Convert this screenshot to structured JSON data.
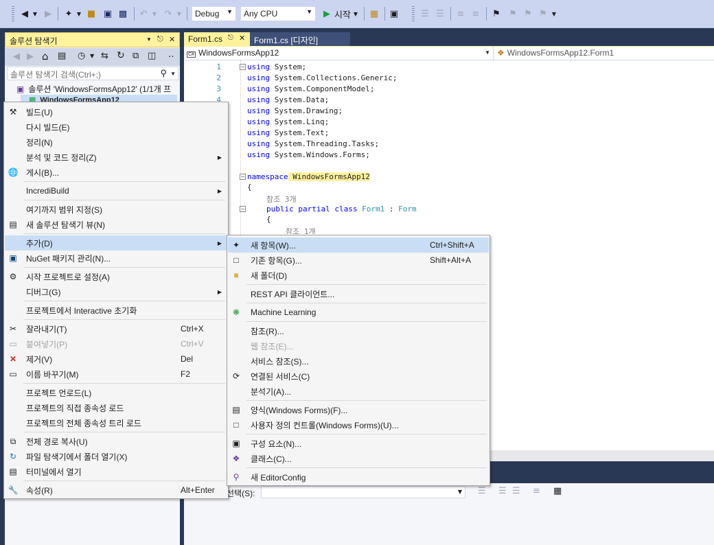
{
  "toolbar": {
    "config": "Debug",
    "platform": "Any CPU",
    "start_label": "시작"
  },
  "solution_explorer": {
    "title": "솔루션 탐색기",
    "search_placeholder": "솔루션 탐색기 검색(Ctrl+;)",
    "solution_item": "솔루션 'WindowsFormsApp12' (1/1개 프",
    "project_item": "WindowsFormsApp12"
  },
  "editor": {
    "tabs": [
      {
        "label": "Form1.cs"
      },
      {
        "label": "Form1.cs [디자인]"
      }
    ],
    "nav_left": "WindowsFormsApp12",
    "nav_right": "WindowsFormsApp12.Form1",
    "line_numbers": [
      "1",
      "2",
      "3",
      "4"
    ],
    "code_lines": [
      {
        "kw": "using",
        "rest": " System;"
      },
      {
        "kw": "using",
        "rest": " System.Collections.Generic;"
      },
      {
        "kw": "using",
        "rest": " System.ComponentModel;"
      },
      {
        "kw": "using",
        "rest": " System.Data;"
      },
      {
        "kw": "using",
        "rest": " System.Drawing;"
      },
      {
        "kw": "using",
        "rest": " System.Linq;"
      },
      {
        "kw": "using",
        "rest": " System.Text;"
      },
      {
        "kw": "using",
        "rest": " System.Threading.Tasks;"
      },
      {
        "kw": "using",
        "rest": " System.Windows.Forms;"
      }
    ],
    "namespace_kw": "namespace",
    "namespace_name": " WindowsFormsApp12",
    "open_brace": "{",
    "ref_count_1": "참조 3개",
    "class_public": "public",
    "class_partial": " partial",
    "class_kw": " class",
    "class_name": " Form1",
    "class_colon": " : ",
    "class_base": "Form",
    "open_brace2": "{",
    "ref_count_2": "참조 1개"
  },
  "properties_bar": {
    "select_label": "선택(S):"
  },
  "context_menu": {
    "items": [
      {
        "label": "빌드(U)",
        "icon": "build-icon"
      },
      {
        "label": "다시 빌드(E)"
      },
      {
        "label": "정리(N)"
      },
      {
        "label": "분석 및 코드 정리(Z)",
        "submenu": true
      },
      {
        "label": "게시(B)...",
        "icon": "globe-icon"
      },
      {
        "label": "IncrediBuild",
        "submenu": true
      },
      {
        "label": "여기까지 범위 지정(S)"
      },
      {
        "label": "새 솔루션 탐색기 뷰(N)",
        "icon": "new-view-icon"
      },
      {
        "label": "추가(D)",
        "submenu": true
      },
      {
        "label": "NuGet 패키지 관리(N)...",
        "icon": "nuget-icon"
      },
      {
        "label": "시작 프로젝트로 설정(A)",
        "icon": "gear-icon"
      },
      {
        "label": "디버그(G)",
        "submenu": true
      },
      {
        "label": "프로젝트에서 Interactive 초기화"
      },
      {
        "label": "잘라내기(T)",
        "shortcut": "Ctrl+X",
        "icon": "cut-icon"
      },
      {
        "label": "붙여넣기(P)",
        "shortcut": "Ctrl+V",
        "icon": "paste-icon",
        "disabled": true
      },
      {
        "label": "제거(V)",
        "shortcut": "Del",
        "icon": "delete-icon"
      },
      {
        "label": "이름 바꾸기(M)",
        "shortcut": "F2",
        "icon": "rename-icon"
      },
      {
        "label": "프로젝트 언로드(L)"
      },
      {
        "label": "프로젝트의 직접 종속성 로드"
      },
      {
        "label": "프로젝트의 전체 종속성 트리 로드"
      },
      {
        "label": "전체 경로 복사(U)",
        "icon": "copy-icon"
      },
      {
        "label": "파일 탐색기에서 폴더 열기(X)",
        "icon": "folder-open-icon"
      },
      {
        "label": "터미널에서 열기",
        "icon": "terminal-icon"
      },
      {
        "label": "속성(R)",
        "shortcut": "Alt+Enter",
        "icon": "wrench-icon"
      }
    ]
  },
  "add_submenu": {
    "items": [
      {
        "label": "새 항목(W)...",
        "shortcut": "Ctrl+Shift+A",
        "icon": "new-item-icon"
      },
      {
        "label": "기존 항목(G)...",
        "shortcut": "Shift+Alt+A",
        "icon": "existing-item-icon"
      },
      {
        "label": "새 폴더(D)",
        "icon": "new-folder-icon"
      },
      {
        "label": "REST API 클라이언트..."
      },
      {
        "label": "Machine Learning",
        "icon": "ml-icon"
      },
      {
        "label": "참조(R)..."
      },
      {
        "label": "웹 참조(E)...",
        "disabled": true
      },
      {
        "label": "서비스 참조(S)..."
      },
      {
        "label": "연결된 서비스(C)",
        "icon": "connected-service-icon"
      },
      {
        "label": "분석기(A)..."
      },
      {
        "label": "양식(Windows Forms)(F)...",
        "icon": "form-icon"
      },
      {
        "label": "사용자 정의 컨트롤(Windows Forms)(U)...",
        "icon": "user-control-icon"
      },
      {
        "label": "구성 요소(N)...",
        "icon": "component-icon"
      },
      {
        "label": "클래스(C)...",
        "icon": "class-icon"
      },
      {
        "label": "새 EditorConfig",
        "icon": "editorconfig-icon"
      }
    ]
  }
}
